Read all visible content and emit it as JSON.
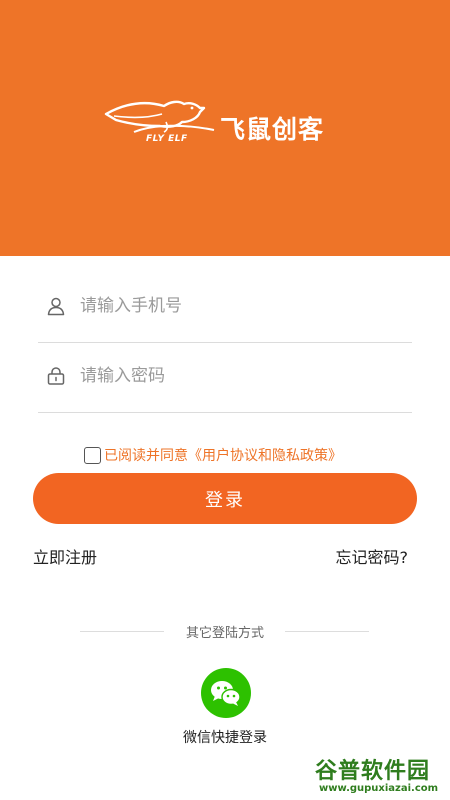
{
  "header": {
    "logo_subtext": "FLY ELF",
    "logo_title": "飞鼠创客",
    "background_color": "#ee7428"
  },
  "form": {
    "phone": {
      "placeholder": "请输入手机号",
      "value": "",
      "icon": "user-icon"
    },
    "password": {
      "placeholder": "请输入密码",
      "value": "",
      "icon": "lock-icon"
    },
    "agreement": {
      "checked": false,
      "prefix": "已阅读并同意",
      "link": "《用户协议和隐私政策》"
    },
    "login_label": "登录",
    "register_label": "立即注册",
    "forgot_label": "忘记密码?"
  },
  "other_login": {
    "label": "其它登陆方式",
    "wechat_label": "微信快捷登录",
    "wechat_icon": "wechat-icon",
    "wechat_color": "#2dc100"
  },
  "watermark": {
    "main": "谷普软件园",
    "url": "www.gupuxiazai.com"
  },
  "colors": {
    "accent": "#f26522",
    "link": "#ee7428"
  }
}
